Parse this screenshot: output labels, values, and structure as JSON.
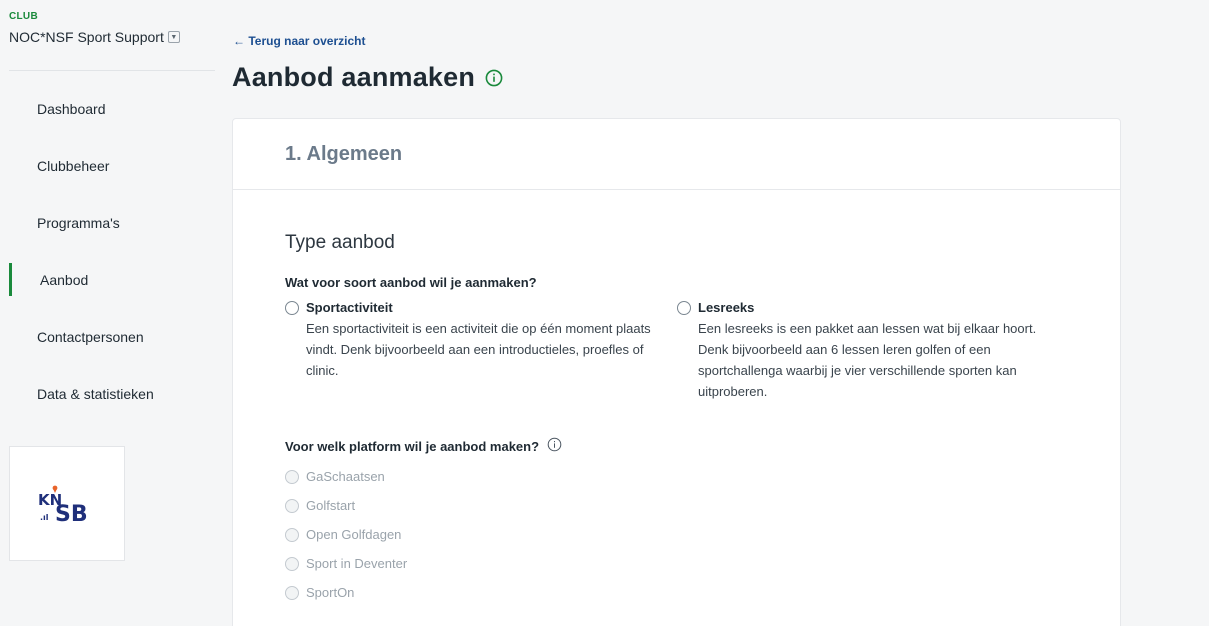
{
  "sidebar": {
    "club_label": "CLUB",
    "club_name": "NOC*NSF Sport Support",
    "items": [
      {
        "label": "Dashboard"
      },
      {
        "label": "Clubbeheer"
      },
      {
        "label": "Programma's"
      },
      {
        "label": "Aanbod"
      },
      {
        "label": "Contactpersonen"
      },
      {
        "label": "Data & statistieken"
      }
    ],
    "logo_text": "KNSB"
  },
  "main": {
    "back_link": "← Terug naar overzicht",
    "title": "Aanbod aanmaken",
    "card": {
      "header": "1. Algemeen",
      "section_title": "Type aanbod",
      "question_type": "Wat voor soort aanbod wil je aanmaken?",
      "options": [
        {
          "title": "Sportactiviteit",
          "description": "Een sportactiviteit is een activiteit die op één moment plaats vindt. Denk bijvoorbeeld aan een introductieles, proefles of clinic."
        },
        {
          "title": "Lesreeks",
          "description": "Een lesreeks is een pakket aan lessen wat bij elkaar hoort. Denk bijvoorbeeld aan 6 lessen leren golfen of een sportchallenga waarbij je vier verschillende sporten kan uitproberen."
        }
      ],
      "question_platform": "Voor welk platform wil je aanbod maken?",
      "platforms": [
        "GaSchaatsen",
        "Golfstart",
        "Open Golfdagen",
        "Sport in Deventer",
        "SportOn"
      ]
    }
  },
  "colors": {
    "accent_green": "#1a8a3c",
    "link_blue": "#1d4f91",
    "background": "#f5f6f7"
  }
}
